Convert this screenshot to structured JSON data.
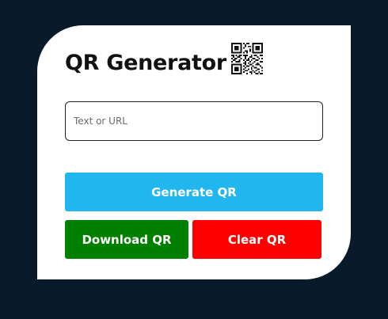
{
  "app": {
    "title": "QR Generator",
    "title_icon": "qr-code-icon"
  },
  "form": {
    "input_placeholder": "Text or URL",
    "input_value": ""
  },
  "buttons": {
    "generate_label": "Generate QR",
    "download_label": "Download QR",
    "clear_label": "Clear QR"
  },
  "colors": {
    "page_background": "#091b2a",
    "card_background": "#ffffff",
    "generate_button": "#22b6ee",
    "download_button": "#018000",
    "clear_button": "#ff0000"
  }
}
